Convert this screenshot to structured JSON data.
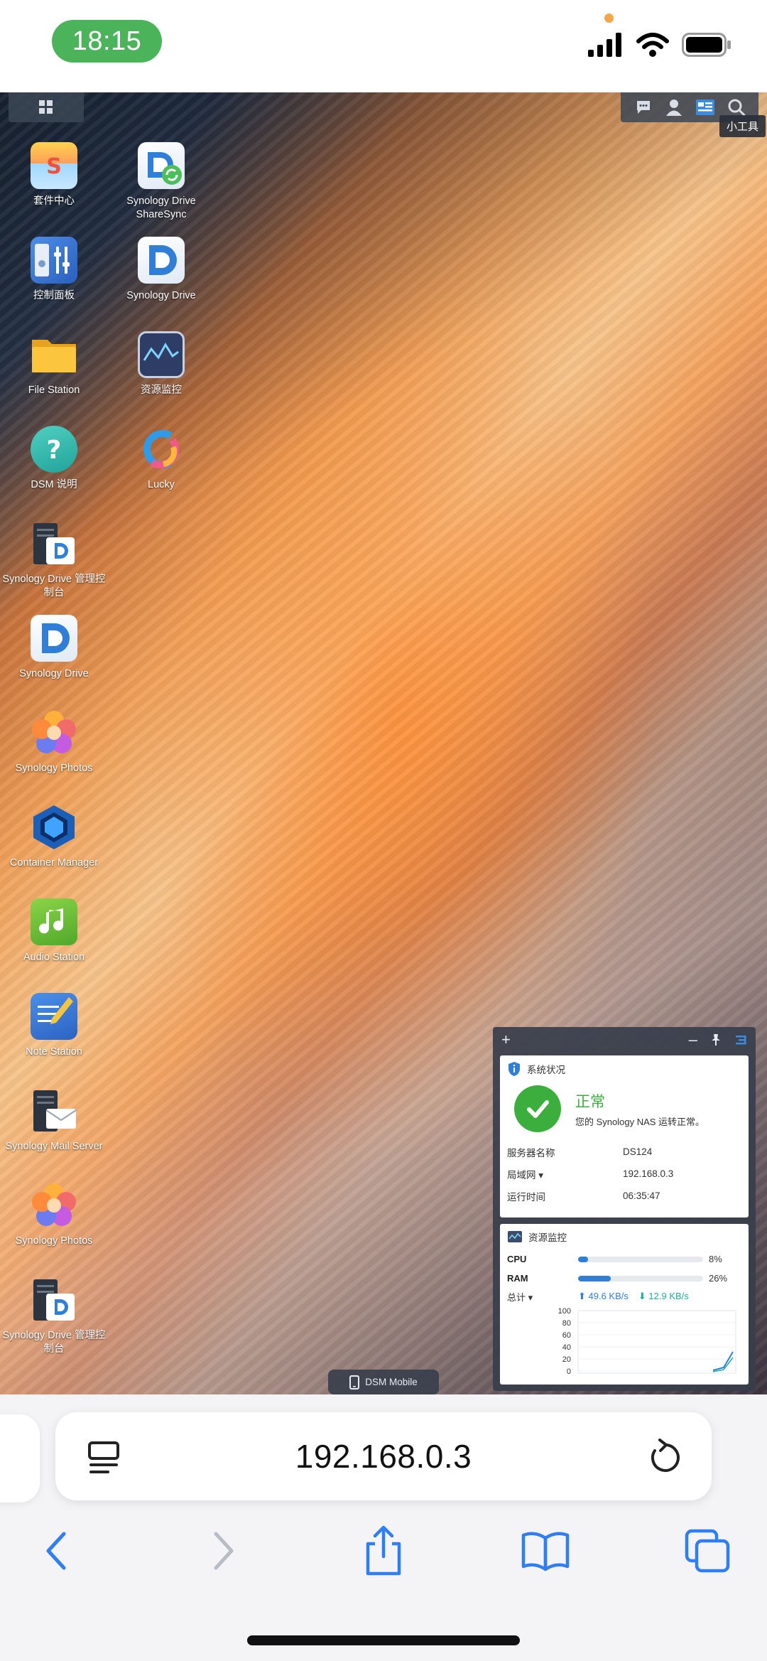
{
  "status_bar": {
    "time": "18:15"
  },
  "desktop": {
    "tooltip": "小工具",
    "apps": [
      {
        "label": "套件中心",
        "icon": "package-center-icon"
      },
      {
        "label": "Synology Drive ShareSync",
        "icon": "drive-sharesync-icon"
      },
      {
        "label": "控制面板",
        "icon": "control-panel-icon"
      },
      {
        "label": "Synology Drive",
        "icon": "synology-drive-icon"
      },
      {
        "label": "File Station",
        "icon": "folder-icon"
      },
      {
        "label": "资源监控",
        "icon": "resource-monitor-icon"
      },
      {
        "label": "DSM 说明",
        "icon": "help-icon"
      },
      {
        "label": "Lucky",
        "icon": "lucky-icon"
      },
      {
        "label": "Synology Drive 管理控制台",
        "icon": "drive-admin-console-icon"
      },
      {
        "label": "Synology Drive",
        "icon": "synology-drive-icon"
      },
      {
        "label": "Synology Photos",
        "icon": "synology-photos-icon"
      },
      {
        "label": "Container Manager",
        "icon": "container-manager-icon"
      },
      {
        "label": "Audio Station",
        "icon": "audio-station-icon"
      },
      {
        "label": "Note Station",
        "icon": "note-station-icon"
      },
      {
        "label": "Synology Mail Server",
        "icon": "mail-server-icon"
      },
      {
        "label": "Synology Photos",
        "icon": "synology-photos-icon"
      },
      {
        "label": "Synology Drive 管理控制台",
        "icon": "drive-admin-console-icon"
      }
    ]
  },
  "widget": {
    "system_status": {
      "title": "系统状况",
      "status": "正常",
      "message": "您的 Synology NAS 运转正常。",
      "rows": [
        {
          "key": "服务器名称",
          "value": "DS124"
        },
        {
          "key": "局域网 ▾",
          "value": "192.168.0.3"
        },
        {
          "key": "运行时间",
          "value": "06:35:47"
        }
      ]
    },
    "resource_monitor": {
      "title": "资源监控",
      "cpu": {
        "label": "CPU",
        "percent": 8,
        "text": "8%"
      },
      "ram": {
        "label": "RAM",
        "percent": 26,
        "text": "26%"
      },
      "total_label": "总计 ▾",
      "upload": "49.6 KB/s",
      "download": "12.9 KB/s",
      "y_ticks": [
        "100",
        "80",
        "60",
        "40",
        "20",
        "0"
      ]
    }
  },
  "dsm_mobile": "DSM Mobile",
  "safari": {
    "url": "192.168.0.3"
  }
}
